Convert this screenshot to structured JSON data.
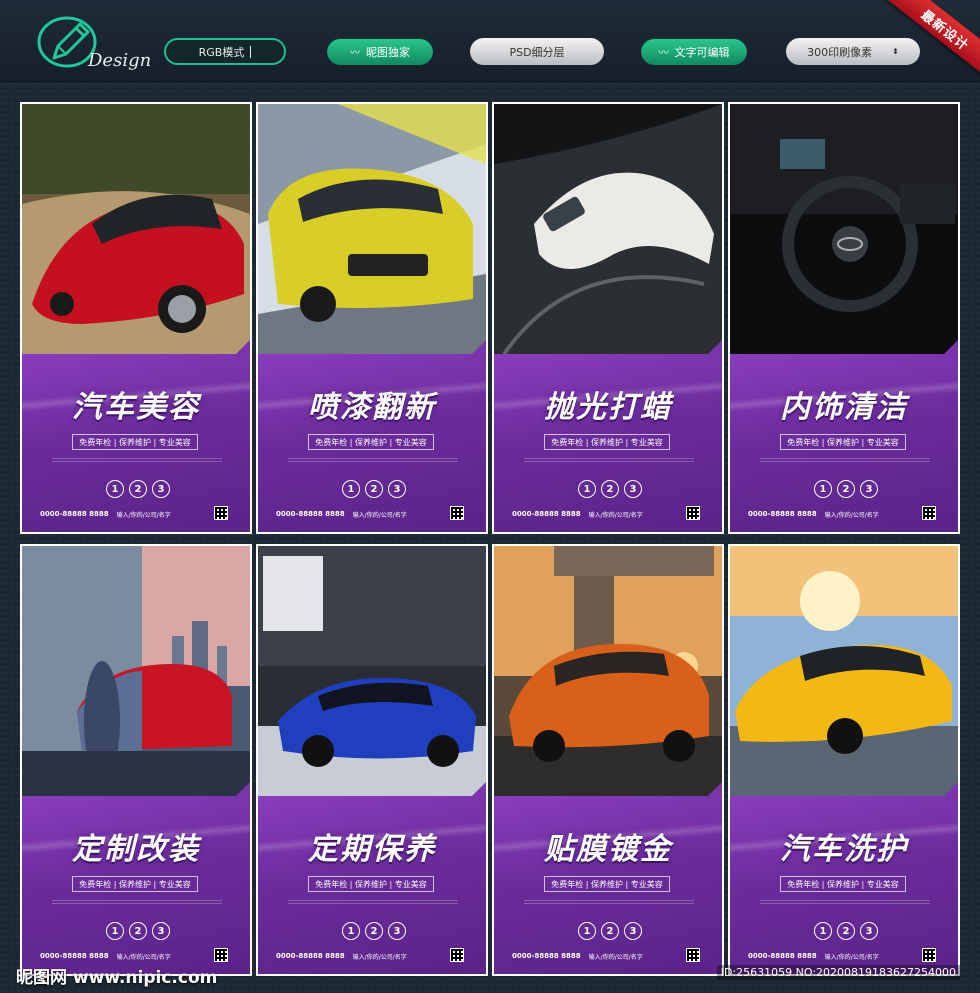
{
  "header": {
    "logo_text": "Design",
    "buttons": [
      {
        "label": "RGB模式",
        "style": "outline"
      },
      {
        "label": "昵图独家",
        "style": "green"
      },
      {
        "label": "PSD细分层",
        "style": "grey"
      },
      {
        "label": "文字可编辑",
        "style": "green"
      },
      {
        "label": "300印刷像素",
        "style": "grey"
      }
    ],
    "corner_label": "最新设计"
  },
  "posters": [
    {
      "title": "汽车美容",
      "image": "red-sports-car"
    },
    {
      "title": "喷漆翻新",
      "image": "yellow-honda-fit"
    },
    {
      "title": "抛光打蜡",
      "image": "gloved-hand-polishing"
    },
    {
      "title": "内饰清洁",
      "image": "audi-interior"
    },
    {
      "title": "定制改装",
      "image": "car-wrap-bmw"
    },
    {
      "title": "定期保养",
      "image": "blue-concept-car"
    },
    {
      "title": "贴膜镀金",
      "image": "orange-audi"
    },
    {
      "title": "汽车洗护",
      "image": "yellow-mclaren"
    }
  ],
  "poster_common": {
    "services": "免费年检 | 保养维护 | 专业美容",
    "steps": [
      "1",
      "2",
      "3"
    ],
    "phone": "0000-88888 8888",
    "address": "输入/你的/公司/名字"
  },
  "watermark": "昵图网 www.nipic.com",
  "id_text": "ID:25631059 NO:20200819183627254000",
  "colors": {
    "accent_green": "#1fbf8f",
    "poster_purple": "#6a2b9a",
    "ribbon_red": "#c81e28"
  }
}
